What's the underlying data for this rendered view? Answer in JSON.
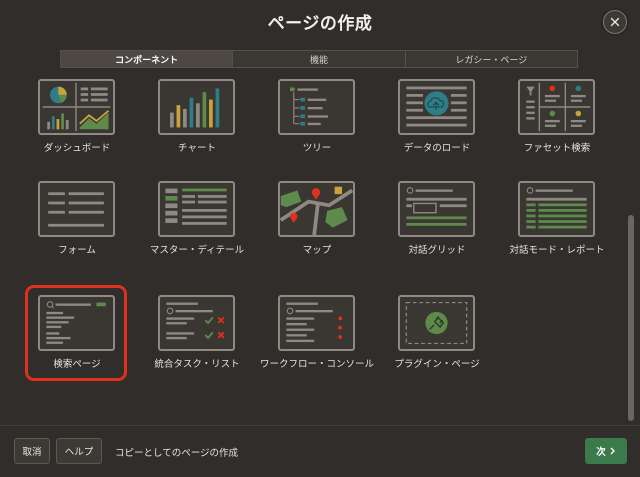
{
  "dialog": {
    "title": "ページの作成"
  },
  "tabs": [
    {
      "label": "コンポーネント",
      "active": true
    },
    {
      "label": "機能",
      "active": false
    },
    {
      "label": "レガシー・ページ",
      "active": false
    }
  ],
  "cards": {
    "dashboard": "ダッシュボード",
    "chart": "チャート",
    "tree": "ツリー",
    "data_load": "データのロード",
    "faceted_search": "ファセット検索",
    "form": "フォーム",
    "master_detail": "マスター・ディテール",
    "map": "マップ",
    "interactive_grid": "対話グリッド",
    "interactive_report": "対話モード・レポート",
    "search_page": "検索ページ",
    "unified_task_list": "統合タスク・リスト",
    "workflow_console": "ワークフロー・コンソール",
    "plugin_page": "プラグイン・ページ"
  },
  "selected_card": "search_page",
  "footer": {
    "cancel_label": "取消",
    "help_label": "ヘルプ",
    "info_text": "コピーとしてのページの作成",
    "next_label": "次",
    "next_icon": "chevron-right-icon"
  },
  "colors": {
    "accent_green": "#3b7a4a",
    "selection_red": "#e0301e",
    "chart_teal": "#2f7d86",
    "chart_yellow": "#c9a33a",
    "chart_green": "#5e8a4c"
  }
}
